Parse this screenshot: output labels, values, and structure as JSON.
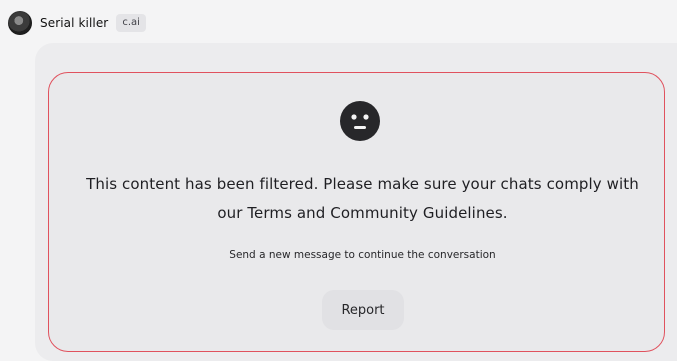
{
  "header": {
    "character_name": "Serial killer",
    "badge": "c.ai",
    "avatar_icon": "character-avatar"
  },
  "filter_notice": {
    "icon": "neutral-face-icon",
    "message": "This content has been filtered. Please make sure your chats comply with our Terms and Community Guidelines.",
    "hint": "Send a new message to continue the conversation",
    "report_label": "Report"
  },
  "colors": {
    "page_background": "#f4f4f5",
    "bubble_background": "#ececee",
    "filter_border": "#e0525e",
    "icon_fill": "#27272a",
    "button_background": "#e1e1e4"
  }
}
